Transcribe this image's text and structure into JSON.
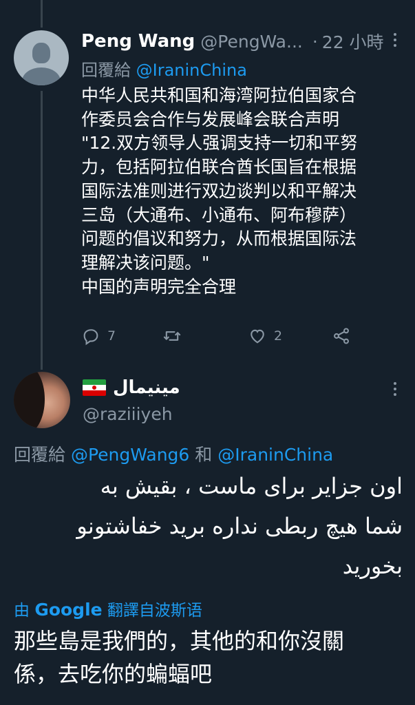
{
  "tweet1": {
    "display_name": "Peng Wang",
    "handle": "@PengWa...",
    "dot": "·",
    "time": "22 小時",
    "reply_prefix": "回覆給",
    "reply_mention": "@IraninChina",
    "body_lines": [
      "中华人民共和国和海湾阿拉伯国家合",
      "作委员会合作与发展峰会联合声明",
      "\"12.双方领导人强调支持一切和平努",
      "力，包括阿拉伯联合酋长国旨在根据",
      "国际法准则进行双边谈判以和平解决",
      "三岛（大通布、小通布、阿布穆萨）",
      "问题的倡议和努力，从而根据国际法",
      "理解决该问题。\"",
      "中国的声明完全合理"
    ],
    "actions": {
      "reply_icon": "reply-icon",
      "reply_count": "7",
      "retweet_icon": "retweet-icon",
      "retweet_count": "",
      "like_icon": "heart-icon",
      "like_count": "2",
      "share_icon": "share-icon"
    }
  },
  "tweet2": {
    "display_name": "مینیمال",
    "flag_icon": "iran-flag-icon",
    "handle": "@raziiiyeh",
    "reply_prefix": "回覆給",
    "reply_mention_1": "@PengWang6",
    "reply_conjunction": "和",
    "reply_mention_2": "@IraninChina",
    "body_lines": [
      "اون جزایر برای ماست ، بقیش به",
      "شما هیچ ربطی نداره برید خفاشتونو",
      "بخورید"
    ],
    "translate_prefix": "由",
    "translate_brand": "Google",
    "translate_suffix": "翻譯自波斯语",
    "translated_lines": [
      "那些島是我們的，其他的和你沒關",
      "係，去吃你的蝙蝠吧"
    ]
  },
  "colors": {
    "background": "#15202b",
    "accent": "#1d9bf0",
    "secondary_text": "#8b98a5",
    "primary_text": "#ffffff"
  }
}
